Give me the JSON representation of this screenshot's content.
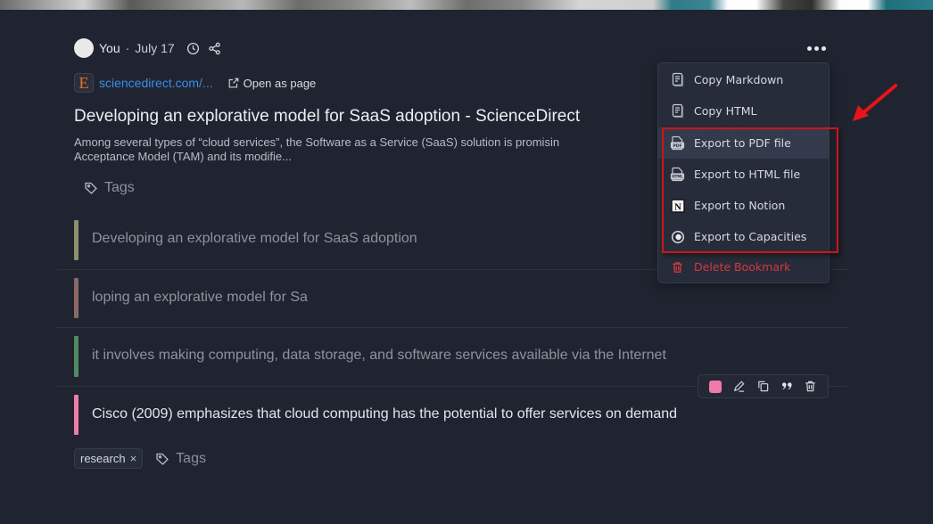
{
  "header": {
    "author": "You",
    "separator": "·",
    "date": "July 17",
    "icons": [
      "clock-icon",
      "share-icon"
    ],
    "more_button": "more-options"
  },
  "source": {
    "favicon_letter": "E",
    "domain": "sciencedirect.com/...",
    "open_as_page": "Open as page"
  },
  "bookmark": {
    "title": "Developing an explorative model for SaaS adoption - ScienceDirect",
    "description_line1": "Among several types of “cloud services”, the Software as a Service (SaaS) solution is promisin",
    "description_line2": "Acceptance Model (TAM) and its modifie...",
    "tags_label": "Tags"
  },
  "highlights": [
    {
      "text": "Developing an explorative model for SaaS adoption",
      "color": "#8b8f6a"
    },
    {
      "text": "loping an explorative model for Sa",
      "color": "#8a6866"
    },
    {
      "text": "it involves making computing, data storage, and software services available via the Internet",
      "color": "#4f8a62"
    },
    {
      "text": "Cisco (2009) emphasizes that cloud computing has the potential to offer services on demand",
      "color": "#f07aa8"
    }
  ],
  "highlight_toolbar": {
    "color_swatch": "#f07aa8",
    "tools": [
      "color-swatch",
      "edit-icon",
      "copy-icon",
      "quote-icon",
      "trash-icon"
    ]
  },
  "bottom_tags": {
    "chips": [
      {
        "label": "research",
        "remove": "×"
      }
    ],
    "add_label": "Tags"
  },
  "menu": {
    "items": [
      {
        "label": "Copy Markdown",
        "icon": "document-icon"
      },
      {
        "label": "Copy HTML",
        "icon": "document-icon"
      },
      {
        "label": "Export to PDF file",
        "icon": "pdf-file-icon"
      },
      {
        "label": "Export to HTML file",
        "icon": "html-file-icon"
      },
      {
        "label": "Export to Notion",
        "icon": "notion-icon"
      },
      {
        "label": "Export to Capacities",
        "icon": "capacities-icon"
      },
      {
        "label": "Delete Bookmark",
        "icon": "trash-icon",
        "danger": true
      }
    ]
  },
  "annotation": {
    "box_color": "#d0141a",
    "arrow_color": "#e8141a"
  }
}
